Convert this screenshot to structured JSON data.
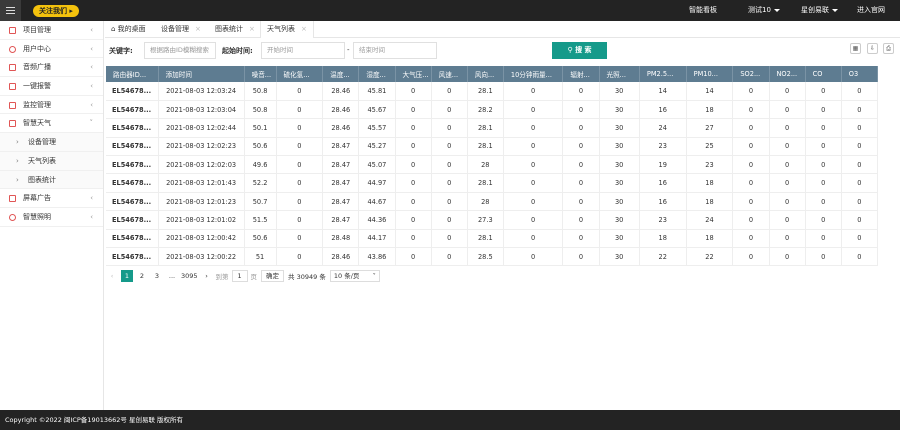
{
  "topbar": {
    "follow_label": "关注我们 ▸",
    "nav": [
      "智能看板",
      "测试10",
      "星创易联",
      "进入官网"
    ]
  },
  "sidebar": {
    "items": [
      {
        "label": "项目管理"
      },
      {
        "label": "用户中心"
      },
      {
        "label": "音频广播"
      },
      {
        "label": "一键报警"
      },
      {
        "label": "监控管理"
      },
      {
        "label": "智慧天气"
      },
      {
        "label": "设备管理"
      },
      {
        "label": "天气列表"
      },
      {
        "label": "图表统计"
      },
      {
        "label": "屏幕广告"
      },
      {
        "label": "智慧照明"
      }
    ]
  },
  "tabs": {
    "home": "我的桌面",
    "t1": "设备管理",
    "t2": "图表统计",
    "t3": "天气列表"
  },
  "filter": {
    "keyword_label": "关键字:",
    "keyword_placeholder": "根据路由ID模糊搜索",
    "time_label": "起始时间:",
    "start_placeholder": "开始时间",
    "sep": "-",
    "end_placeholder": "结束时间",
    "search_label": "搜 索"
  },
  "table": {
    "headers": [
      "路由器ID...",
      "添加时间",
      "噪音...",
      "硫化氢...",
      "温度...",
      "湿度...",
      "大气压...",
      "风速...",
      "风向...",
      "10分钟雨量...",
      "辐射...",
      "光照...",
      "PM2.5...",
      "PM10...",
      "SO2...",
      "NO2...",
      "CO",
      "O3"
    ],
    "rows": [
      [
        "EL54678...",
        "2021-08-03 12:03:24",
        "50.8",
        "0",
        "28.46",
        "45.81",
        "0",
        "0",
        "28.1",
        "0",
        "0",
        "30",
        "14",
        "14",
        "0",
        "0",
        "0",
        "0"
      ],
      [
        "EL54678...",
        "2021-08-03 12:03:04",
        "50.8",
        "0",
        "28.46",
        "45.67",
        "0",
        "0",
        "28.2",
        "0",
        "0",
        "30",
        "16",
        "18",
        "0",
        "0",
        "0",
        "0"
      ],
      [
        "EL54678...",
        "2021-08-03 12:02:44",
        "50.1",
        "0",
        "28.46",
        "45.57",
        "0",
        "0",
        "28.1",
        "0",
        "0",
        "30",
        "24",
        "27",
        "0",
        "0",
        "0",
        "0"
      ],
      [
        "EL54678...",
        "2021-08-03 12:02:23",
        "50.6",
        "0",
        "28.47",
        "45.27",
        "0",
        "0",
        "28.1",
        "0",
        "0",
        "30",
        "23",
        "25",
        "0",
        "0",
        "0",
        "0"
      ],
      [
        "EL54678...",
        "2021-08-03 12:02:03",
        "49.6",
        "0",
        "28.47",
        "45.07",
        "0",
        "0",
        "28",
        "0",
        "0",
        "30",
        "19",
        "23",
        "0",
        "0",
        "0",
        "0"
      ],
      [
        "EL54678...",
        "2021-08-03 12:01:43",
        "52.2",
        "0",
        "28.47",
        "44.97",
        "0",
        "0",
        "28.1",
        "0",
        "0",
        "30",
        "16",
        "18",
        "0",
        "0",
        "0",
        "0"
      ],
      [
        "EL54678...",
        "2021-08-03 12:01:23",
        "50.7",
        "0",
        "28.47",
        "44.67",
        "0",
        "0",
        "28",
        "0",
        "0",
        "30",
        "16",
        "18",
        "0",
        "0",
        "0",
        "0"
      ],
      [
        "EL54678...",
        "2021-08-03 12:01:02",
        "51.5",
        "0",
        "28.47",
        "44.36",
        "0",
        "0",
        "27.3",
        "0",
        "0",
        "30",
        "23",
        "24",
        "0",
        "0",
        "0",
        "0"
      ],
      [
        "EL54678...",
        "2021-08-03 12:00:42",
        "50.6",
        "0",
        "28.48",
        "44.17",
        "0",
        "0",
        "28.1",
        "0",
        "0",
        "30",
        "18",
        "18",
        "0",
        "0",
        "0",
        "0"
      ],
      [
        "EL54678...",
        "2021-08-03 12:00:22",
        "51",
        "0",
        "28.46",
        "43.86",
        "0",
        "0",
        "28.5",
        "0",
        "0",
        "30",
        "22",
        "22",
        "0",
        "0",
        "0",
        "0"
      ]
    ]
  },
  "pager": {
    "pages": [
      "1",
      "2",
      "3",
      "...",
      "3095"
    ],
    "goto_label": "到第",
    "goto_value": "1",
    "page_unit": "页",
    "ok_label": "确定",
    "total": "共 30949 条",
    "per_page": "10 条/页"
  },
  "footer": "Copyright ©2022 闽ICP备19013662号 星创易联 版权所有"
}
